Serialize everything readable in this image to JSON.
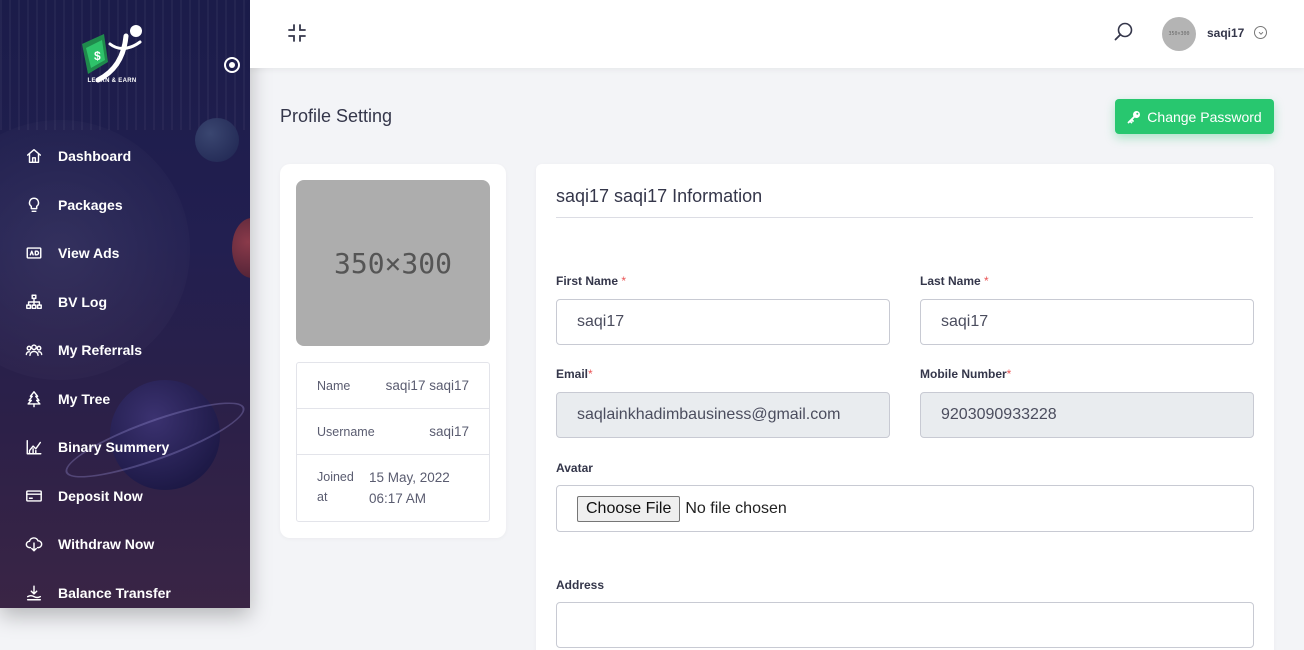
{
  "sidebar": {
    "logo_text": "LEARN & EARN",
    "items": [
      {
        "label": "Dashboard",
        "icon": "home-icon"
      },
      {
        "label": "Packages",
        "icon": "lightbulb-icon"
      },
      {
        "label": "View Ads",
        "icon": "ad-icon"
      },
      {
        "label": "BV Log",
        "icon": "sitemap-icon"
      },
      {
        "label": "My Referrals",
        "icon": "users-icon"
      },
      {
        "label": "My Tree",
        "icon": "tree-icon"
      },
      {
        "label": "Binary Summery",
        "icon": "chart-icon"
      },
      {
        "label": "Deposit Now",
        "icon": "credit-card-icon"
      },
      {
        "label": "Withdraw Now",
        "icon": "cloud-download-icon"
      },
      {
        "label": "Balance Transfer",
        "icon": "transfer-icon"
      }
    ]
  },
  "header": {
    "username": "saqi17",
    "avatar_text": "350×300"
  },
  "page": {
    "title": "Profile Setting",
    "change_password_label": "Change Password"
  },
  "profile": {
    "image_text": "350×300",
    "rows": [
      {
        "key": "Name",
        "value": "saqi17 saqi17"
      },
      {
        "key": "Username",
        "value": "saqi17"
      },
      {
        "key": "Joined at",
        "value": "15 May, 2022 06:17 AM"
      }
    ]
  },
  "form": {
    "title": "saqi17 saqi17 Information",
    "first_name": {
      "label": "First Name",
      "value": "saqi17"
    },
    "last_name": {
      "label": "Last Name",
      "value": "saqi17"
    },
    "email": {
      "label": "Email",
      "value": "saqlainkhadimbausiness@gmail.com"
    },
    "mobile": {
      "label": "Mobile Number",
      "value": "9203090933228"
    },
    "avatar": {
      "label": "Avatar",
      "button": "Choose File",
      "status": "No file chosen"
    },
    "address": {
      "label": "Address",
      "value": ""
    },
    "required_mark": "*"
  },
  "colors": {
    "accent_green": "#28c76f",
    "required_red": "#ea5455",
    "sidebar_bg": "#1b1c4a"
  }
}
